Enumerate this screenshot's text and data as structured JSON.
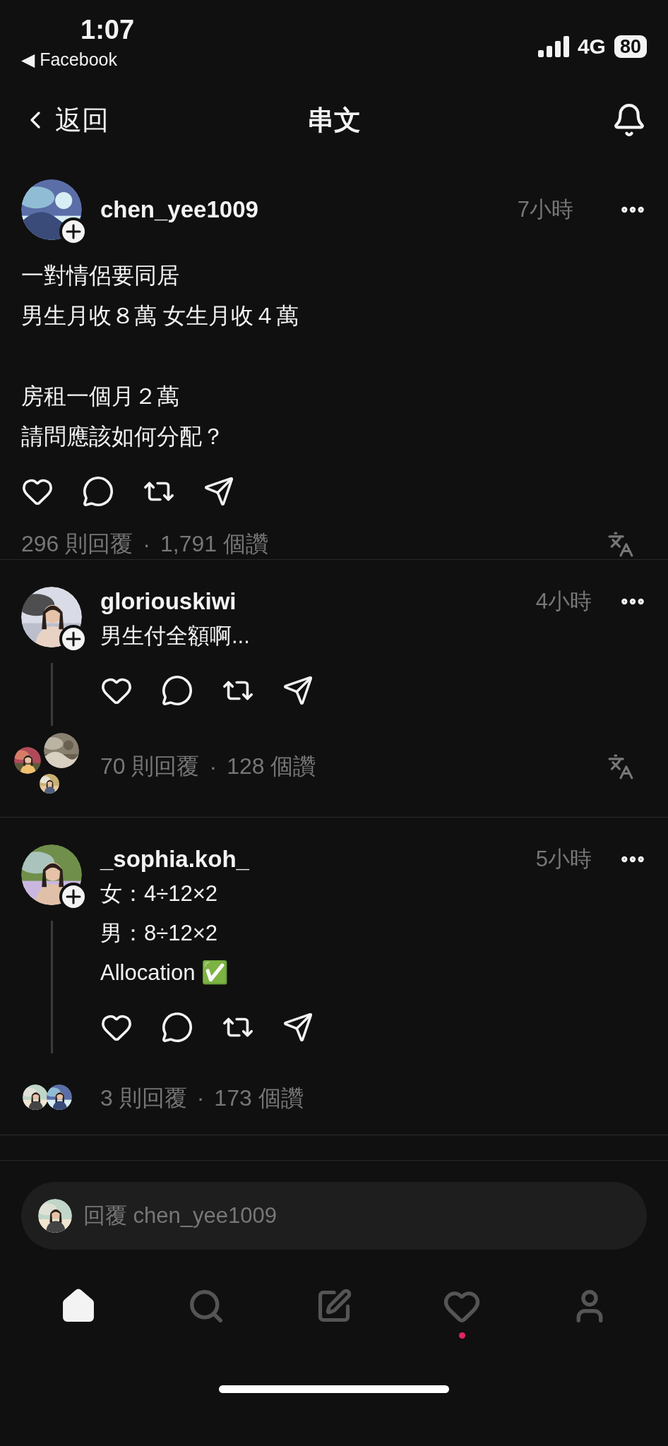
{
  "status_bar": {
    "time": "1:07",
    "back_app": "◀ Facebook",
    "network": "4G",
    "battery": "80"
  },
  "header": {
    "back_label": "返回",
    "title": "串文"
  },
  "post": {
    "username": "chen_yee1009",
    "time": "7小時",
    "paragraphs": [
      [
        "一對情侶要同居",
        "男生月收８萬 女生月收４萬"
      ],
      [
        "房租一個月２萬",
        "請問應該如何分配？"
      ]
    ],
    "replies": "296 則回覆",
    "separator": "·",
    "likes": "1,791 個讚",
    "translate": true
  },
  "comments": [
    {
      "username": "gloriouskiwi",
      "time": "4小時",
      "lines": [
        "男生付全額啊..."
      ],
      "replies": "70 則回覆",
      "separator": "·",
      "likes": "128 個讚",
      "translate": true,
      "reply_avatars": [
        {
          "kind": "picture"
        },
        {
          "kind": "picture"
        },
        {
          "kind": "picture"
        }
      ]
    },
    {
      "username": "_sophia.koh_",
      "time": "5小時",
      "lines": [
        "女：4÷12×2",
        "男：8÷12×2",
        "Allocation ✅"
      ],
      "replies": "3 則回覆",
      "separator": "·",
      "likes": "173 個讚",
      "translate": false,
      "reply_avatars": [
        {
          "kind": "picture"
        },
        {
          "kind": "picture"
        }
      ]
    }
  ],
  "reply_field": {
    "placeholder": "回覆 chen_yee1009"
  },
  "nav": [
    {
      "kind": "home",
      "selected": true,
      "badge": false
    },
    {
      "kind": "search",
      "selected": false,
      "badge": false
    },
    {
      "kind": "compose",
      "selected": false,
      "badge": false
    },
    {
      "kind": "activity",
      "selected": false,
      "badge": true
    },
    {
      "kind": "profile",
      "selected": false,
      "badge": false
    }
  ]
}
